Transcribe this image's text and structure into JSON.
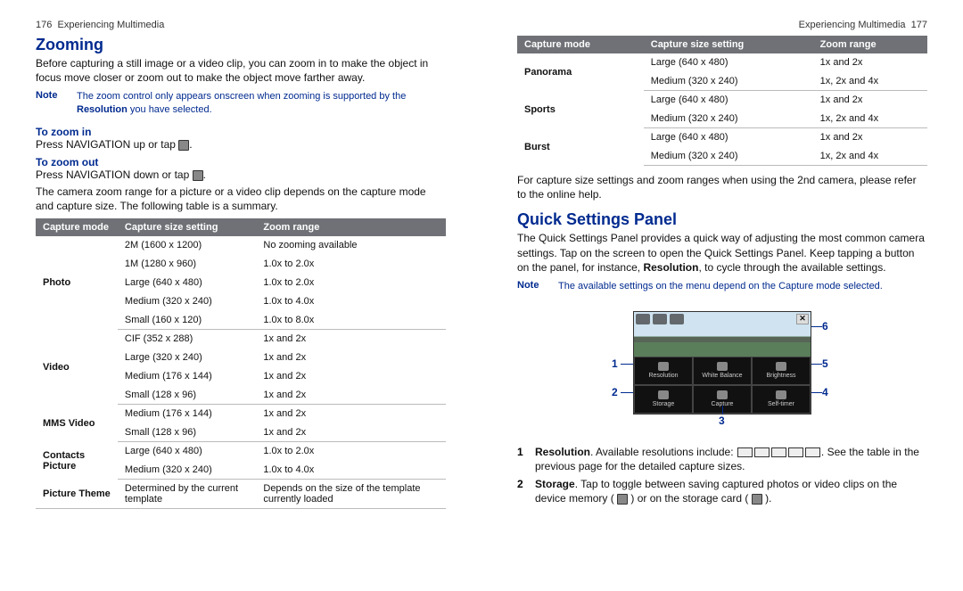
{
  "left": {
    "header_page": "176",
    "header_text": "Experiencing Multimedia",
    "h_zooming": "Zooming",
    "zoom_intro": "Before capturing a still image or a video clip, you can zoom in to make the object in focus move closer or zoom out to make the object move farther away.",
    "note_label": "Note",
    "note_text_a": "The zoom control only appears onscreen when zooming is supported by the ",
    "note_text_b": "Resolution",
    "note_text_c": " you have selected.",
    "to_zoom_in": "To zoom in",
    "zoom_in_instr": "Press NAVIGATION up or tap ",
    "to_zoom_out": "To zoom out",
    "zoom_out_instr": "Press NAVIGATION down or tap ",
    "period": ".",
    "range_intro": "The camera zoom range for a picture or a video clip depends on the capture mode and capture size. The following table is a summary.",
    "th_mode": "Capture mode",
    "th_size": "Capture size setting",
    "th_range": "Zoom range",
    "rows": [
      {
        "mode": "Photo",
        "span": 5,
        "size": "2M (1600 x 1200)",
        "range": "No zooming available",
        "sep": false
      },
      {
        "mode": "",
        "size": "1M (1280 x 960)",
        "range": "1.0x to 2.0x",
        "sep": false
      },
      {
        "mode": "",
        "size": "Large (640 x 480)",
        "range": "1.0x to 2.0x",
        "sep": false
      },
      {
        "mode": "",
        "size": "Medium (320 x 240)",
        "range": "1.0x to 4.0x",
        "sep": false
      },
      {
        "mode": "",
        "size": "Small (160 x 120)",
        "range": "1.0x to 8.0x",
        "sep": true
      },
      {
        "mode": "Video",
        "span": 4,
        "size": "CIF (352 x 288)",
        "range": "1x and 2x",
        "sep": false
      },
      {
        "mode": "",
        "size": "Large (320 x 240)",
        "range": "1x and 2x",
        "sep": false
      },
      {
        "mode": "",
        "size": "Medium (176 x 144)",
        "range": "1x and 2x",
        "sep": false
      },
      {
        "mode": "",
        "size": "Small (128 x 96)",
        "range": "1x and 2x",
        "sep": true
      },
      {
        "mode": "MMS Video",
        "span": 2,
        "size": "Medium (176 x 144)",
        "range": "1x and 2x",
        "sep": false
      },
      {
        "mode": "",
        "size": "Small (128 x 96)",
        "range": "1x and 2x",
        "sep": true
      },
      {
        "mode": "Contacts Picture",
        "span": 2,
        "size": "Large (640 x 480)",
        "range": "1.0x to 2.0x",
        "sep": false
      },
      {
        "mode": "",
        "size": "Medium (320 x 240)",
        "range": "1.0x to 4.0x",
        "sep": true
      },
      {
        "mode": "Picture Theme",
        "span": 1,
        "size": "Determined by the current template",
        "range": "Depends on the size of the template currently loaded",
        "sep": true
      }
    ]
  },
  "right": {
    "header_text": "Experiencing Multimedia",
    "header_page": "177",
    "th_mode": "Capture mode",
    "th_size": "Capture size setting",
    "th_range": "Zoom range",
    "rows": [
      {
        "mode": "Panorama",
        "span": 2,
        "size": "Large (640 x 480)",
        "range": "1x and 2x",
        "sep": false
      },
      {
        "mode": "",
        "size": "Medium (320 x 240)",
        "range": "1x, 2x and 4x",
        "sep": true
      },
      {
        "mode": "Sports",
        "span": 2,
        "size": "Large (640 x 480)",
        "range": "1x and 2x",
        "sep": false
      },
      {
        "mode": "",
        "size": "Medium (320 x 240)",
        "range": "1x, 2x and 4x",
        "sep": true
      },
      {
        "mode": "Burst",
        "span": 2,
        "size": "Large (640 x 480)",
        "range": "1x and 2x",
        "sep": false
      },
      {
        "mode": "",
        "size": "Medium (320 x 240)",
        "range": "1x, 2x and 4x",
        "sep": true
      }
    ],
    "after_table": "For capture size settings and zoom ranges when using the 2nd camera, please refer to the online help.",
    "h_qsp": "Quick Settings Panel",
    "qsp_intro_a": "The Quick Settings Panel provides a quick way of adjusting the most common camera settings. Tap on the screen to open the Quick Settings Panel. Keep tapping a button on the panel, for instance, ",
    "qsp_intro_b": "Resolution",
    "qsp_intro_c": ", to cycle through the available settings.",
    "note_label": "Note",
    "note_text": "The available settings on the menu depend on the Capture mode selected.",
    "callouts": {
      "c1": "1",
      "c2": "2",
      "c3": "3",
      "c4": "4",
      "c5": "5",
      "c6": "6"
    },
    "cells": {
      "r1c1": "Resolution",
      "r1c2": "White Balance",
      "r1c3": "Brightness",
      "r2c1": "Storage",
      "r2c2": "Capture",
      "r2c3": "Self-timer"
    },
    "legend1_num": "1",
    "legend1_a": "Resolution",
    "legend1_b": ". Available resolutions include: ",
    "legend1_c": "See the table in the previous page for the detailed capture sizes.",
    "legend2_num": "2",
    "legend2_a": "Storage",
    "legend2_b": ". Tap to toggle between saving captured photos or video clips on the device memory ( ",
    "legend2_c": " ) or on the storage card ( ",
    "legend2_d": " )."
  }
}
